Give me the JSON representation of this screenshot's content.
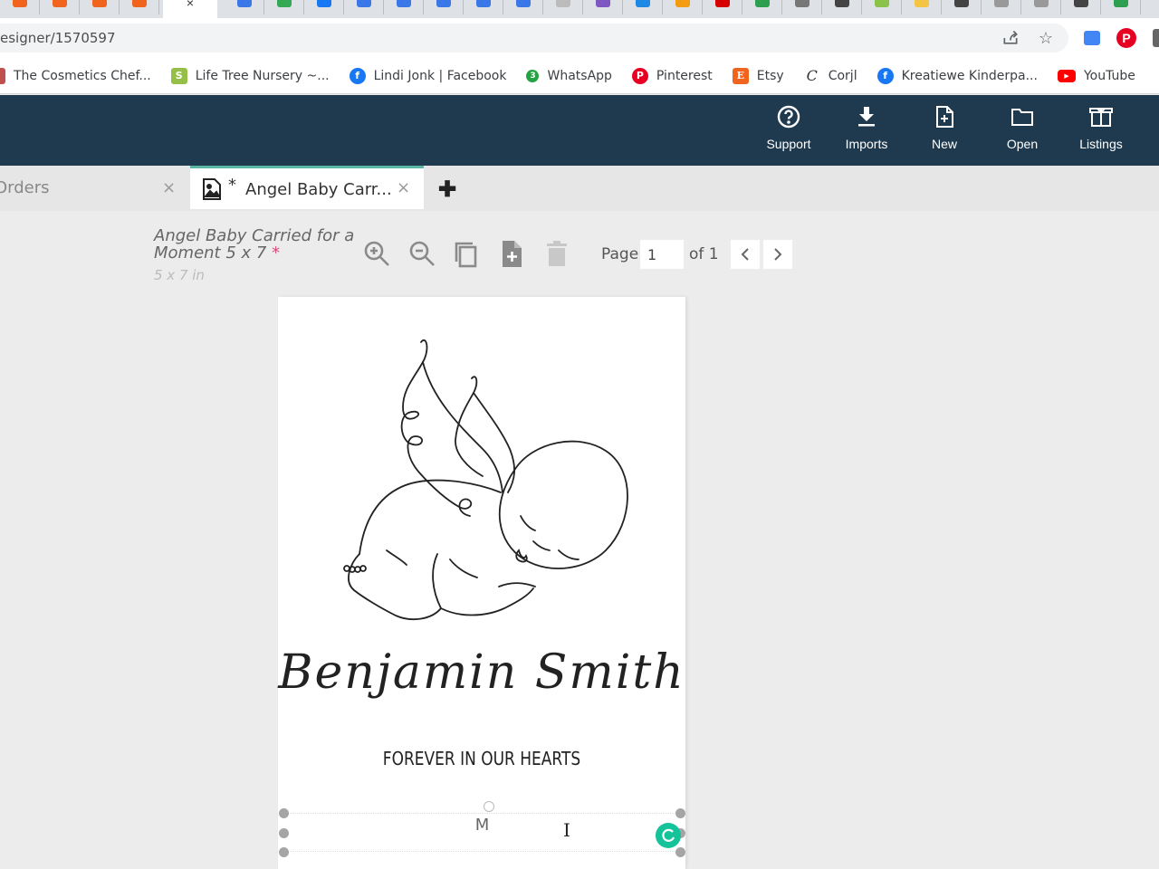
{
  "browser": {
    "tab_favicons": [
      {
        "name": "etsy-tab-icon",
        "color": "#f1641e"
      },
      {
        "name": "etsy-tab-icon",
        "color": "#f1641e"
      },
      {
        "name": "etsy-tab-icon",
        "color": "#f1641e"
      },
      {
        "name": "etsy-tab-icon",
        "color": "#f1641e"
      }
    ],
    "active_tab_close": "×",
    "url": "esigner/1570597",
    "share_icon": "⇪",
    "star_icon": "☆"
  },
  "bookmarks": [
    {
      "label": "The Cosmetics Chef...",
      "icon": "cosmetics-icon",
      "color": "#c0504d",
      "glyph": ""
    },
    {
      "label": "Life Tree Nursery ~...",
      "icon": "shopify-icon",
      "color": "#95bf47",
      "glyph": "S"
    },
    {
      "label": "Lindi Jonk | Facebook",
      "icon": "facebook-icon",
      "color": "#1877f2",
      "glyph": "f"
    },
    {
      "label": "WhatsApp",
      "icon": "whatsapp-icon",
      "color": "#25a244",
      "glyph": "3"
    },
    {
      "label": "Pinterest",
      "icon": "pinterest-icon",
      "color": "#e60023",
      "glyph": "P"
    },
    {
      "label": "Etsy",
      "icon": "etsy-icon",
      "color": "#f1641e",
      "glyph": "E"
    },
    {
      "label": "Corjl",
      "icon": "corjl-icon",
      "color": "#ffffff",
      "glyph": "C"
    },
    {
      "label": "Kreatiewe Kinderpa...",
      "icon": "facebook-icon",
      "color": "#1877f2",
      "glyph": "f"
    },
    {
      "label": "YouTube",
      "icon": "youtube-icon",
      "color": "#ff0000",
      "glyph": "▶"
    }
  ],
  "appbar": {
    "bg_color": "#1f3a4f",
    "buttons": [
      {
        "label": "Support",
        "icon": "help-circle-icon"
      },
      {
        "label": "Imports",
        "icon": "download-icon"
      },
      {
        "label": "New",
        "icon": "new-file-icon"
      },
      {
        "label": "Open",
        "icon": "folder-icon"
      },
      {
        "label": "Listings",
        "icon": "box-icon"
      }
    ]
  },
  "doc_tabs": {
    "inactive_label": "Orders",
    "active_modified_marker": "*",
    "active_label": "Angel Baby Carr...",
    "close_glyph": "×",
    "add_glyph": "✚",
    "accent_color": "#5bb5a4"
  },
  "toolbar": {
    "doc_title": "Angel Baby Carried for a Moment 5 x 7",
    "unsaved_marker": "*",
    "doc_size": "5 x 7 in",
    "page_label": "Page",
    "page_value": "1",
    "of_label": "of 1",
    "prev_glyph": "‹",
    "next_glyph": "›"
  },
  "canvas": {
    "name_text": "Benjamin Smith",
    "tagline": "FOREVER IN OUR HEARTS",
    "editing_text": "M",
    "cursor_glyph": "I"
  }
}
